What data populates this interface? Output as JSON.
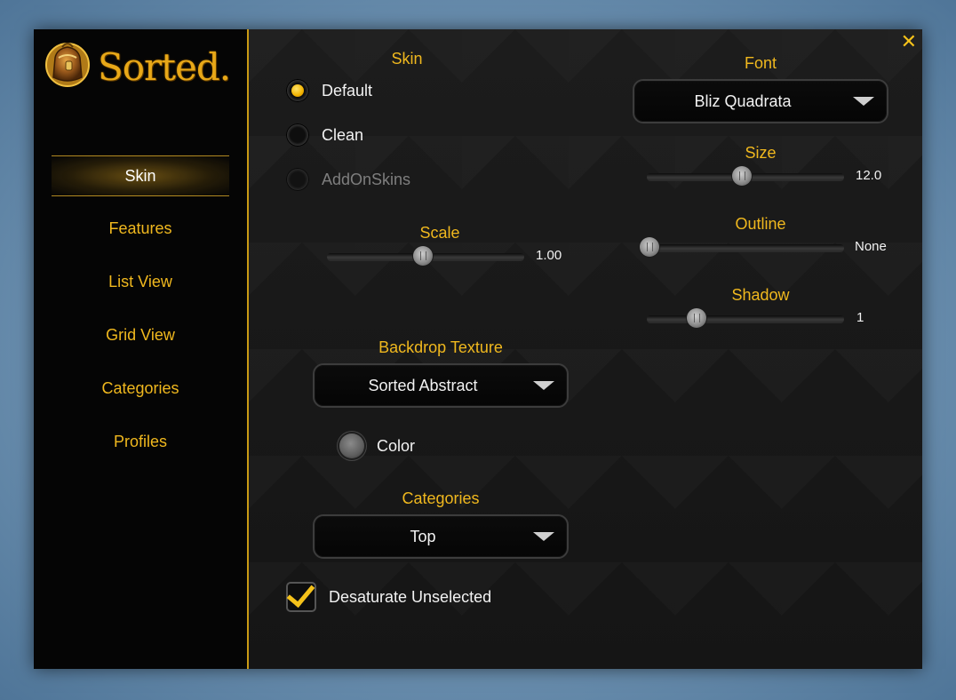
{
  "app": {
    "logo_text": "Sorted."
  },
  "sidebar": {
    "items": [
      {
        "label": "Skin",
        "active": true
      },
      {
        "label": "Features"
      },
      {
        "label": "List View"
      },
      {
        "label": "Grid View"
      },
      {
        "label": "Categories"
      },
      {
        "label": "Profiles"
      }
    ]
  },
  "skin": {
    "title": "Skin",
    "options": [
      {
        "label": "Default",
        "selected": true,
        "disabled": false
      },
      {
        "label": "Clean",
        "selected": false,
        "disabled": false
      },
      {
        "label": "AddOnSkins",
        "selected": false,
        "disabled": true
      }
    ]
  },
  "scale": {
    "label": "Scale",
    "value": "1.00",
    "fraction": 0.5
  },
  "backdrop": {
    "label": "Backdrop Texture",
    "selected": "Sorted Abstract"
  },
  "color": {
    "label": "Color",
    "swatch": "#6a6a6a"
  },
  "categories": {
    "label": "Categories",
    "selected": "Top"
  },
  "desaturate": {
    "label": "Desaturate Unselected",
    "checked": true
  },
  "font": {
    "label": "Font",
    "selected": "Bliz Quadrata",
    "size": {
      "label": "Size",
      "value": "12.0",
      "fraction": 0.5
    },
    "outline": {
      "label": "Outline",
      "value": "None",
      "fraction": 0.0
    },
    "shadow": {
      "label": "Shadow",
      "value": "1",
      "fraction": 0.25
    }
  },
  "colors": {
    "accent": "#f0b81e",
    "divider": "#c99a14"
  },
  "icons": {
    "close": "✕"
  }
}
